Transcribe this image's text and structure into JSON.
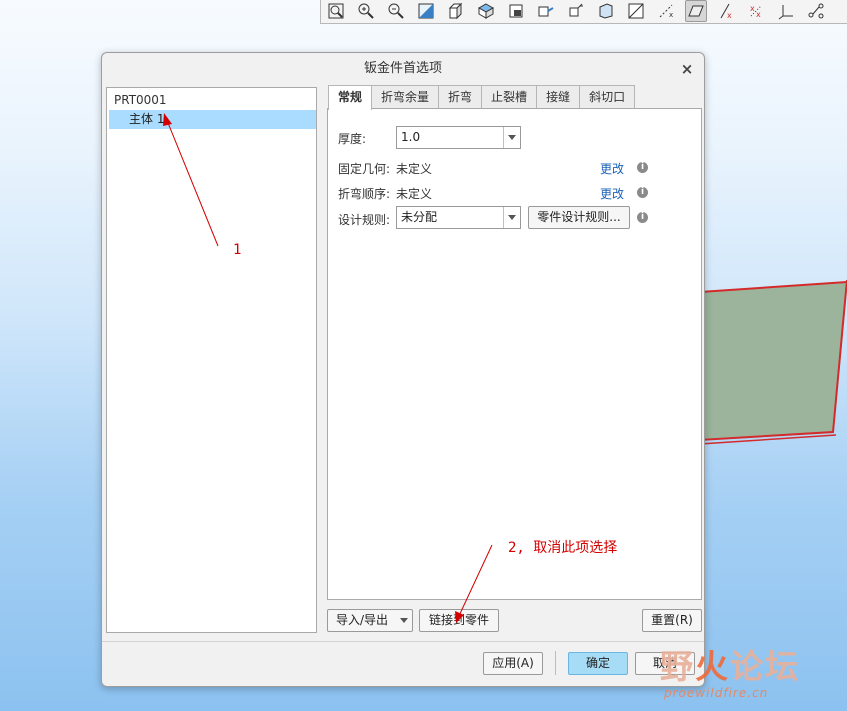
{
  "toolbar": {
    "icons": [
      "zoom-fit-icon",
      "zoom-in-icon",
      "zoom-out-icon",
      "refit-icon",
      "view-orient-icon",
      "saved-views-icon",
      "display-style-icon",
      "perspective-icon",
      "spin-center-icon",
      "datum-display-icon",
      "annotation-display-icon",
      "plane-display-icon",
      "axis-display-icon",
      "point-display-icon",
      "csys-display-icon",
      "sketch-display-icon"
    ]
  },
  "dialog": {
    "title": "钣金件首选项",
    "close_glyph": "×",
    "tree": {
      "root": "PRT0001",
      "child": "主体 1"
    },
    "tabs": [
      "常规",
      "折弯余量",
      "折弯",
      "止裂槽",
      "接缝",
      "斜切口"
    ],
    "active_tab": "常规",
    "fields": {
      "thickness_label": "厚度:",
      "thickness_value": "1.0",
      "fixed_geom_label": "固定几何:",
      "fixed_geom_value": "未定义",
      "fixed_geom_link": "更改",
      "bend_order_label": "折弯顺序:",
      "bend_order_value": "未定义",
      "bend_order_link": "更改",
      "design_rule_label": "设计规则:",
      "design_rule_value": "未分配",
      "design_rule_button": "零件设计规则..."
    },
    "buttons": {
      "import_export": "导入/导出",
      "link_to_part": "链接到零件",
      "reset": "重置(R)",
      "apply": "应用(A)",
      "ok": "确定",
      "cancel": "取消"
    }
  },
  "annotations": {
    "note1": "1",
    "note2": "2, 取消此项选择"
  },
  "watermark": {
    "title_a": "野",
    "title_b": "火",
    "title_c": "论坛",
    "url": "proewildfire.cn"
  },
  "colors": {
    "selection": "#aadcff",
    "link": "#1a63b8",
    "annotation": "#d40000",
    "primary_button": "#a7dcf6"
  }
}
